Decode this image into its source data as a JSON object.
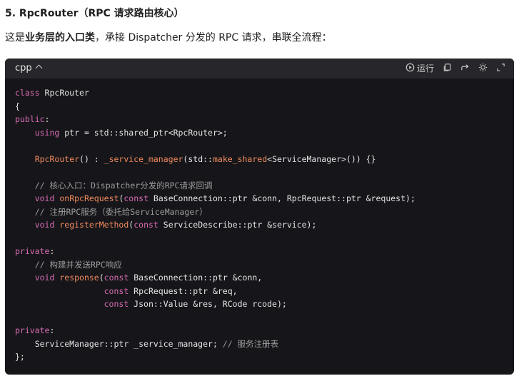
{
  "heading": "5. RpcRouter（RPC 请求路由核心）",
  "intro": {
    "before": "这是",
    "bold": "业务层的入口类",
    "after": "，承接 Dispatcher 分发的 RPC 请求，串联全流程："
  },
  "code_block": {
    "language": "cpp",
    "run_label": "运行",
    "toolbar_icons": [
      "run-icon",
      "copy-icon",
      "share-icon",
      "theme-icon",
      "expand-icon"
    ],
    "lines": [
      [
        {
          "t": "kw",
          "v": "class"
        },
        {
          "t": "",
          "v": " RpcRouter"
        }
      ],
      [
        {
          "t": "",
          "v": "{"
        }
      ],
      [
        {
          "t": "kw",
          "v": "public"
        },
        {
          "t": "",
          "v": ":"
        }
      ],
      [
        {
          "t": "",
          "v": "    "
        },
        {
          "t": "kw",
          "v": "using"
        },
        {
          "t": "",
          "v": " ptr = std::shared_ptr<RpcRouter>;"
        }
      ],
      [],
      [
        {
          "t": "",
          "v": "    "
        },
        {
          "t": "fn",
          "v": "RpcRouter"
        },
        {
          "t": "",
          "v": "() : "
        },
        {
          "t": "fn",
          "v": "_service_manager"
        },
        {
          "t": "",
          "v": "(std::"
        },
        {
          "t": "fn",
          "v": "make_shared"
        },
        {
          "t": "",
          "v": "<ServiceManager>()) {}"
        }
      ],
      [],
      [
        {
          "t": "cm",
          "v": "    // 核心入口：Dispatcher分发的RPC请求回调"
        }
      ],
      [
        {
          "t": "",
          "v": "    "
        },
        {
          "t": "kw",
          "v": "void"
        },
        {
          "t": "",
          "v": " "
        },
        {
          "t": "fn",
          "v": "onRpcRequest"
        },
        {
          "t": "",
          "v": "("
        },
        {
          "t": "kw",
          "v": "const"
        },
        {
          "t": "",
          "v": " BaseConnection::ptr &conn, RpcRequest::ptr &request);"
        }
      ],
      [
        {
          "t": "cm",
          "v": "    // 注册RPC服务（委托给ServiceManager）"
        }
      ],
      [
        {
          "t": "",
          "v": "    "
        },
        {
          "t": "kw",
          "v": "void"
        },
        {
          "t": "",
          "v": " "
        },
        {
          "t": "fn",
          "v": "registerMethod"
        },
        {
          "t": "",
          "v": "("
        },
        {
          "t": "kw",
          "v": "const"
        },
        {
          "t": "",
          "v": " ServiceDescribe::ptr &service);"
        }
      ],
      [],
      [
        {
          "t": "kw",
          "v": "private"
        },
        {
          "t": "",
          "v": ":"
        }
      ],
      [
        {
          "t": "cm",
          "v": "    // 构建并发送RPC响应"
        }
      ],
      [
        {
          "t": "",
          "v": "    "
        },
        {
          "t": "kw",
          "v": "void"
        },
        {
          "t": "",
          "v": " "
        },
        {
          "t": "fn",
          "v": "response"
        },
        {
          "t": "",
          "v": "("
        },
        {
          "t": "kw",
          "v": "const"
        },
        {
          "t": "",
          "v": " BaseConnection::ptr &conn,"
        }
      ],
      [
        {
          "t": "",
          "v": "                  "
        },
        {
          "t": "kw",
          "v": "const"
        },
        {
          "t": "",
          "v": " RpcRequest::ptr &req,"
        }
      ],
      [
        {
          "t": "",
          "v": "                  "
        },
        {
          "t": "kw",
          "v": "const"
        },
        {
          "t": "",
          "v": " Json::Value &res, RCode rcode);"
        }
      ],
      [],
      [
        {
          "t": "kw",
          "v": "private"
        },
        {
          "t": "",
          "v": ":"
        }
      ],
      [
        {
          "t": "",
          "v": "    ServiceManager::ptr _service_manager; "
        },
        {
          "t": "cm",
          "v": "// 服务注册表"
        }
      ],
      [
        {
          "t": "",
          "v": "};"
        }
      ]
    ]
  }
}
